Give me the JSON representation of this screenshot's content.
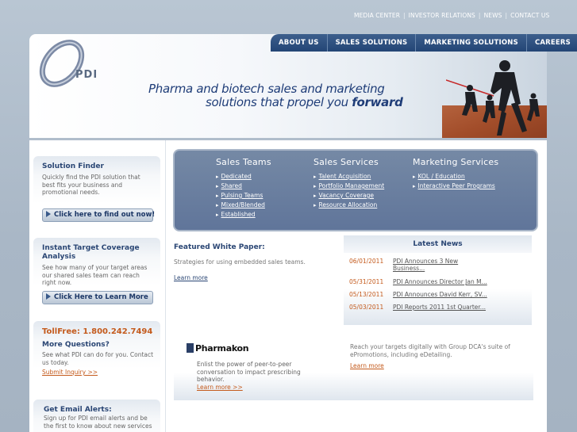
{
  "top_links": [
    "MEDIA CENTER",
    "INVESTOR RELATIONS",
    "NEWS",
    "CONTACT US"
  ],
  "nav": [
    "ABOUT US",
    "SALES SOLUTIONS",
    "MARKETING SOLUTIONS",
    "CAREERS"
  ],
  "header": {
    "logo": "PDI",
    "tagline_line1": "Pharma and biotech sales and marketing",
    "tagline_line2": "solutions that propel you",
    "tagline_emphasis": "forward"
  },
  "sidebar": {
    "solution_finder": {
      "title": "Solution Finder",
      "text": "Quickly find the PDI solution that best fits your business and promotional needs.",
      "button": "Click here to find out now!"
    },
    "coverage": {
      "title": "Instant Target Coverage Analysis",
      "text": "See how many of your target areas our shared sales team can reach right now.",
      "button": "Click Here to Learn More"
    },
    "contact": {
      "tollfree": "TollFree: 1.800.242.7494",
      "title": "More Questions?",
      "text": "See what PDI can do for you. Contact us today.",
      "link": "Submit Inquiry >>"
    },
    "alerts": {
      "title": "Get Email Alerts:",
      "text": "Sign up for PDI email alerts and be the first to know about new services"
    }
  },
  "services": {
    "sales_teams": {
      "title": "Sales Teams",
      "items": [
        "Dedicated",
        "Shared",
        "Pulsing Teams",
        "Mixed/Blended",
        "Established"
      ]
    },
    "sales_services": {
      "title": "Sales Services",
      "items": [
        "Talent Acquisition",
        "Portfolio Management",
        "Vacancy Coverage",
        "Resource Allocation"
      ]
    },
    "marketing_services": {
      "title": "Marketing Services",
      "items": [
        "KOL / Education",
        "Interactive Peer Programs"
      ]
    }
  },
  "featured": {
    "title": "Featured White Paper:",
    "text": "Strategies for using embedded sales teams.",
    "link": "Learn more"
  },
  "news": {
    "title": "Latest News",
    "items": [
      {
        "date": "06/01/2011",
        "title": "PDI Announces 3 New",
        "title2": "Business..."
      },
      {
        "date": "05/31/2011",
        "title": "PDI Announces Director Jan M..."
      },
      {
        "date": "05/13/2011",
        "title": "PDI Announces David Kerr, SV..."
      },
      {
        "date": "05/03/2011",
        "title": "PDI Reports 2011 1st Quarter..."
      }
    ]
  },
  "promo": {
    "brand": "Pharmakon",
    "left_text": "Enlist the power of peer-to-peer conversation to impact prescribing behavior.",
    "left_link": "Learn more >>",
    "right_text": "Reach your targets digitally with Group DCA's suite of ePromotions, including eDetailing.",
    "right_link": "Learn more"
  }
}
